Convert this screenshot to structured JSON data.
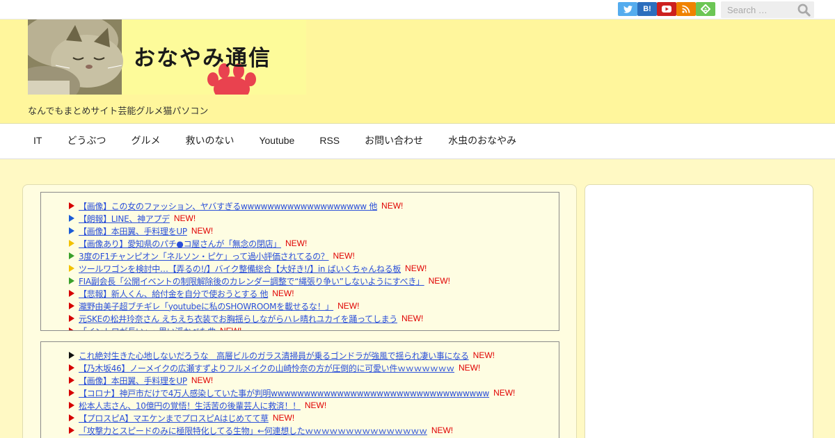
{
  "search": {
    "placeholder": "Search …"
  },
  "social": {
    "items": [
      {
        "name": "twitter-icon",
        "color": "#55acee",
        "label": ""
      },
      {
        "name": "hatena-bookmark-icon",
        "color": "#2c6ebd",
        "label": "B!"
      },
      {
        "name": "youtube-icon",
        "color": "#cd201f",
        "label": ""
      },
      {
        "name": "rss-icon",
        "color": "#f08200",
        "label": ""
      },
      {
        "name": "feedly-icon",
        "color": "#6cc655",
        "label": ""
      }
    ]
  },
  "header": {
    "logo_text": "おなやみ通信",
    "tagline": "なんでもまとめサイト芸能グルメ猫パソコン"
  },
  "nav": {
    "items": [
      "IT",
      "どうぶつ",
      "グルメ",
      "救いのない",
      "Youtube",
      "RSS",
      "お問い合わせ",
      "水虫のおなやみ"
    ]
  },
  "feed1": {
    "new_label": "NEW!",
    "items": [
      {
        "text": "【画像】この女のファッション、ヤバすぎるwwwwwwwwwwwwwwwwwww 他",
        "color": "#d60000"
      },
      {
        "text": "【朗報】LINE、神アプデ",
        "color": "#1a5bd6"
      },
      {
        "text": "【画像】本田翼、手料理をUP",
        "color": "#1a5bd6"
      },
      {
        "text": "【画像あり】愛知県のパチ●コ屋さんが「無念の閉店」",
        "color": "#f2c200"
      },
      {
        "text": "3度のF1チャンピオン「ネルソン・ピケ」って過小評価されてるの？",
        "color": "#3aa02a"
      },
      {
        "text": "ツールワゴンを検討中…【弄るの!/】バイク整備総合【大好き!/】in ばいくちゃんねる板",
        "color": "#f2c200"
      },
      {
        "text": "FIA副会長「公開イベントの制限解除後のカレンダー調整で“縄張り争い”しないようにすべき」",
        "color": "#3aa02a"
      },
      {
        "text": "【悲報】新人くん、給付金を自分で使おうとする 他",
        "color": "#d60000"
      },
      {
        "text": "瀧野由美子超ブチギレ「youtubeに私のSHOWROOMを載せるな！」",
        "color": "#d60000"
      },
      {
        "text": "元SKEの松井玲奈さん えちえち衣装でお胸揺らしながらハレ晴れユカイを踊ってしまう",
        "color": "#d60000"
      },
      {
        "text": "「イントロが長い」←思い浮かべた曲",
        "color": "#d60000"
      }
    ]
  },
  "feed2": {
    "new_label": "NEW!",
    "items": [
      {
        "text": "これ絶対生きた心地しないだろうな　高層ビルのガラス清掃員が乗るゴンドラが強風で揺られ凄い事になる",
        "color": "#111111"
      },
      {
        "text": "【乃木坂46】ノーメイクの広瀬すずよりフルメイクの山崎怜奈の方が圧倒的に可愛い件ｗｗｗｗｗｗｗ",
        "color": "#d60000"
      },
      {
        "text": "【画像】本田翼、手料理をUP",
        "color": "#d60000"
      },
      {
        "text": "【コロナ】神戸市だけで4万人感染していた事が判明wwwwwwwwwwwwwwwwwwwwwwwwwwwwwwwww",
        "color": "#d60000"
      },
      {
        "text": "松本人志さん、10億円の覚悟！生活苦の後輩芸人に救済！！",
        "color": "#d60000"
      },
      {
        "text": "【プロスピA】マエケンまでプロスピAはじめてて草",
        "color": "#d60000"
      },
      {
        "text": "「攻撃力とスピードのみに極限特化してる生物」←何連想したｗｗｗｗｗｗｗｗｗｗｗｗｗｗｗ",
        "color": "#d60000"
      }
    ]
  }
}
